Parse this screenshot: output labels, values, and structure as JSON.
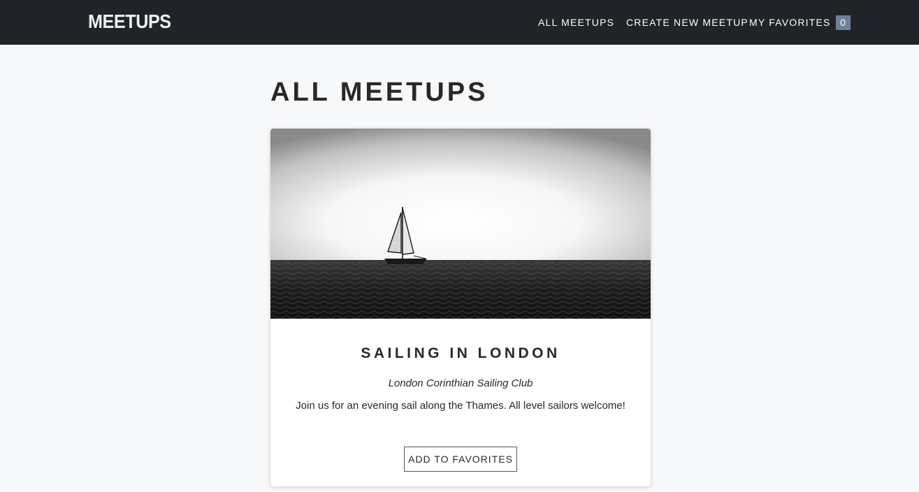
{
  "header": {
    "logo": "MEETUPS",
    "nav": {
      "all_meetups": "ALL MEETUPS",
      "create_new_meetup": "CREATE NEW MEETUP",
      "my_favorites": "MY FAVORITES",
      "favorites_count": "0"
    }
  },
  "main": {
    "title": "ALL MEETUPS",
    "meetups": [
      {
        "title": "SAILING IN LONDON",
        "address": "London Corinthian Sailing Club",
        "description": "Join us for an evening sail along the Thames. All level sailors welcome!",
        "button_label": "ADD TO FAVORITES"
      }
    ]
  },
  "colors": {
    "header_bg": "#202328",
    "page_bg": "#f7f8fa",
    "badge_bg": "#6f8199",
    "text_dark": "#2b2728"
  }
}
